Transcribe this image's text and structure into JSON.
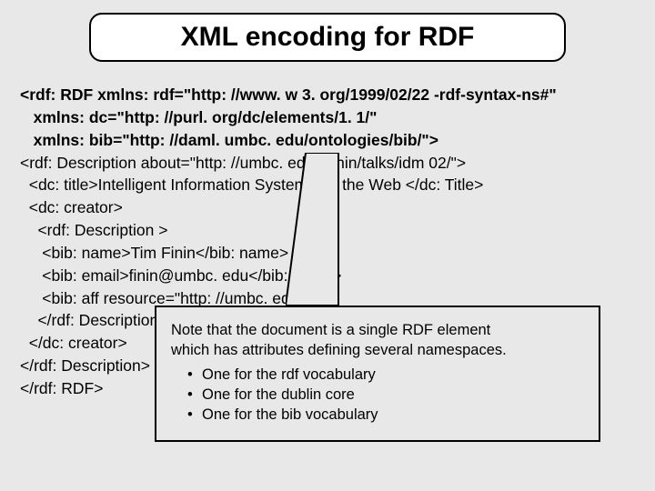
{
  "title": "XML encoding for RDF",
  "code": {
    "l1": "<rdf: RDF xmlns: rdf=\"http: //www. w 3. org/1999/02/22 -rdf-syntax-ns#\"",
    "l2": "   xmlns: dc=\"http: //purl. org/dc/elements/1. 1/\"",
    "l3": "   xmlns: bib=\"http: //daml. umbc. edu/ontologies/bib/\">",
    "l4": "<rdf: Description about=\"http: //umbc. edu/~finin/talks/idm 02/\">",
    "l5": "  <dc: title>Intelligent Information Systems on the Web </dc: Title>",
    "l6": "  <dc: creator>",
    "l7": "    <rdf: Description >",
    "l8": "     <bib: name>Tim Finin</bib: name>",
    "l9": "     <bib: email>finin@umbc. edu</bib: Email>",
    "l10": "     <bib: aff resource=\"http: //umbc. edu/\" />",
    "l11": "    </rdf: Description>",
    "l12": "  </dc: creator>",
    "l13": "</rdf: Description>",
    "l14": "</rdf: RDF>"
  },
  "callout": {
    "p1": "Note that the document is a single RDF element",
    "p2": "which has attributes defining several namespaces.",
    "b1": "One for the rdf vocabulary",
    "b2": "One for the dublin core",
    "b3": "One for the bib vocabulary",
    "dot": "•"
  }
}
